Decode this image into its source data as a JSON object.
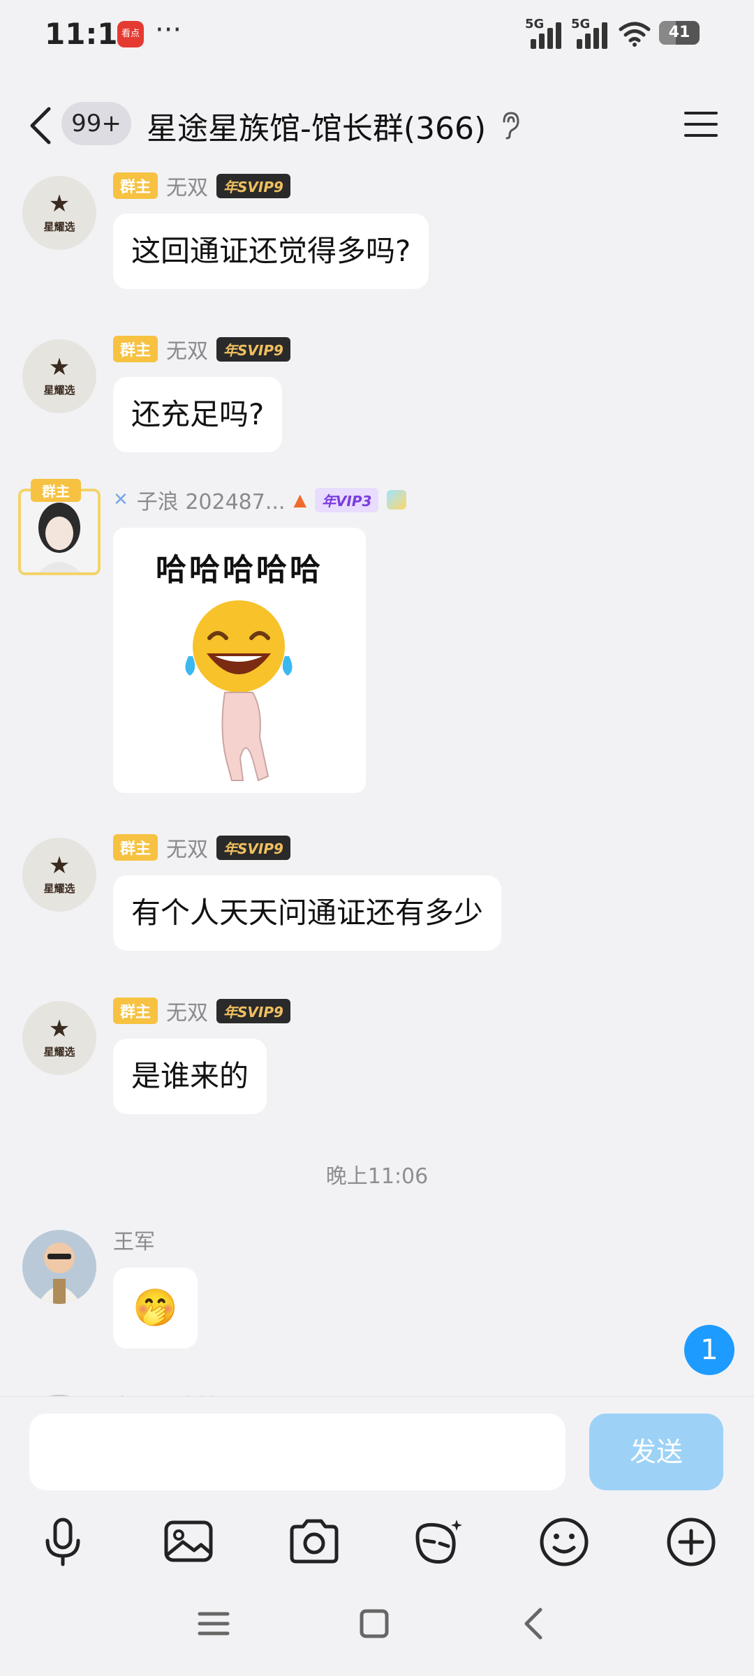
{
  "status_bar": {
    "time": "11:12",
    "news_app_label": "看点",
    "more": "···",
    "net1": "5G",
    "net2": "5G",
    "battery": "41",
    "battery_level": 0.41
  },
  "header": {
    "unread_count": "99+",
    "title": "星途星族馆-馆长群(366)"
  },
  "messages": [
    {
      "role_badge": "群主",
      "sender": "无双",
      "vip": "年SVIP9",
      "text": "这回通证还觉得多吗?",
      "avatar_label": "星耀选"
    },
    {
      "role_badge": "群主",
      "sender": "无双",
      "vip": "年SVIP9",
      "text": "还充足吗?",
      "avatar_label": "星耀选"
    },
    {
      "role_badge": "群主",
      "sender": "子浪 202487...",
      "vip": "年VIP3",
      "sticker_text": "哈哈哈哈哈"
    },
    {
      "role_badge": "群主",
      "sender": "无双",
      "vip": "年SVIP9",
      "text": "有个人天天问通证还有多少",
      "avatar_label": "星耀选"
    },
    {
      "role_badge": "群主",
      "sender": "无双",
      "vip": "年SVIP9",
      "text": "是谁来的",
      "avatar_label": "星耀选"
    }
  ],
  "time_divider": "晚上11:06",
  "last_message": {
    "sender": "王军",
    "emoji": "🤭"
  },
  "partial_sender": "东北网购镇子",
  "new_message_count": "1",
  "input": {
    "placeholder": "",
    "send_label": "发送"
  },
  "toolbar": [
    "mic-icon",
    "image-icon",
    "camera-icon",
    "emoji-mask-icon",
    "smiley-icon",
    "plus-icon"
  ],
  "colors": {
    "accent": "#1e9bff",
    "owner_badge": "#f7c242",
    "send_disabled": "#9dd2f6",
    "background": "#f2f2f5"
  }
}
